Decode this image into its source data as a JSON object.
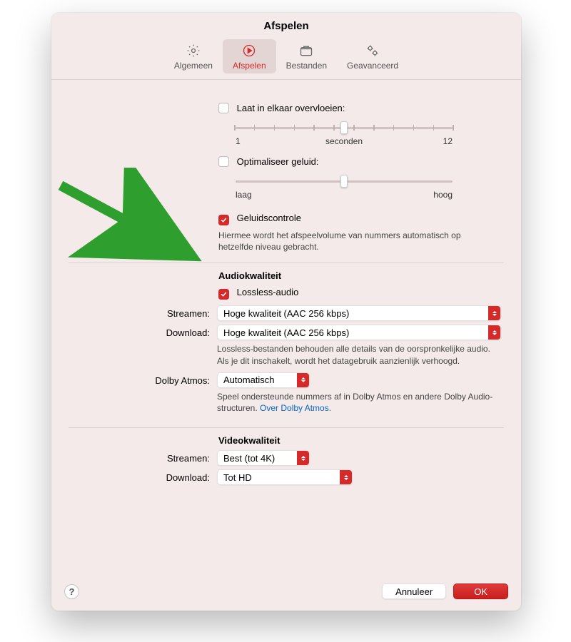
{
  "title": "Afspelen",
  "tabs": [
    {
      "label": "Algemeen"
    },
    {
      "label": "Afspelen"
    },
    {
      "label": "Bestanden"
    },
    {
      "label": "Geavanceerd"
    }
  ],
  "crossfade": {
    "label": "Laat in elkaar overvloeien:",
    "min": "1",
    "unit": "seconden",
    "max": "12"
  },
  "optimize": {
    "label": "Optimaliseer geluid:",
    "low": "laag",
    "high": "hoog"
  },
  "soundcheck": {
    "label": "Geluidscontrole",
    "desc": "Hiermee wordt het afspeelvolume van nummers automatisch op hetzelfde niveau gebracht."
  },
  "audio": {
    "heading": "Audiokwaliteit",
    "lossless_label": "Lossless-audio",
    "stream_label": "Streamen:",
    "stream_value": "Hoge kwaliteit (AAC 256 kbps)",
    "download_label": "Download:",
    "download_value": "Hoge kwaliteit (AAC 256 kbps)",
    "lossless_desc": "Lossless-bestanden behouden alle details van de oorspronkelijke audio. Als je dit inschakelt, wordt het datagebruik aanzienlijk verhoogd.",
    "dolby_label": "Dolby Atmos:",
    "dolby_value": "Automatisch",
    "dolby_desc": "Speel ondersteunde nummers af in Dolby Atmos en andere Dolby Audio-structuren. ",
    "dolby_link": "Over Dolby Atmos."
  },
  "video": {
    "heading": "Videokwaliteit",
    "stream_label": "Streamen:",
    "stream_value": "Best (tot 4K)",
    "download_label": "Download:",
    "download_value": "Tot HD"
  },
  "footer": {
    "cancel": "Annuleer",
    "ok": "OK"
  },
  "colors": {
    "accent": "#d62a2a"
  }
}
